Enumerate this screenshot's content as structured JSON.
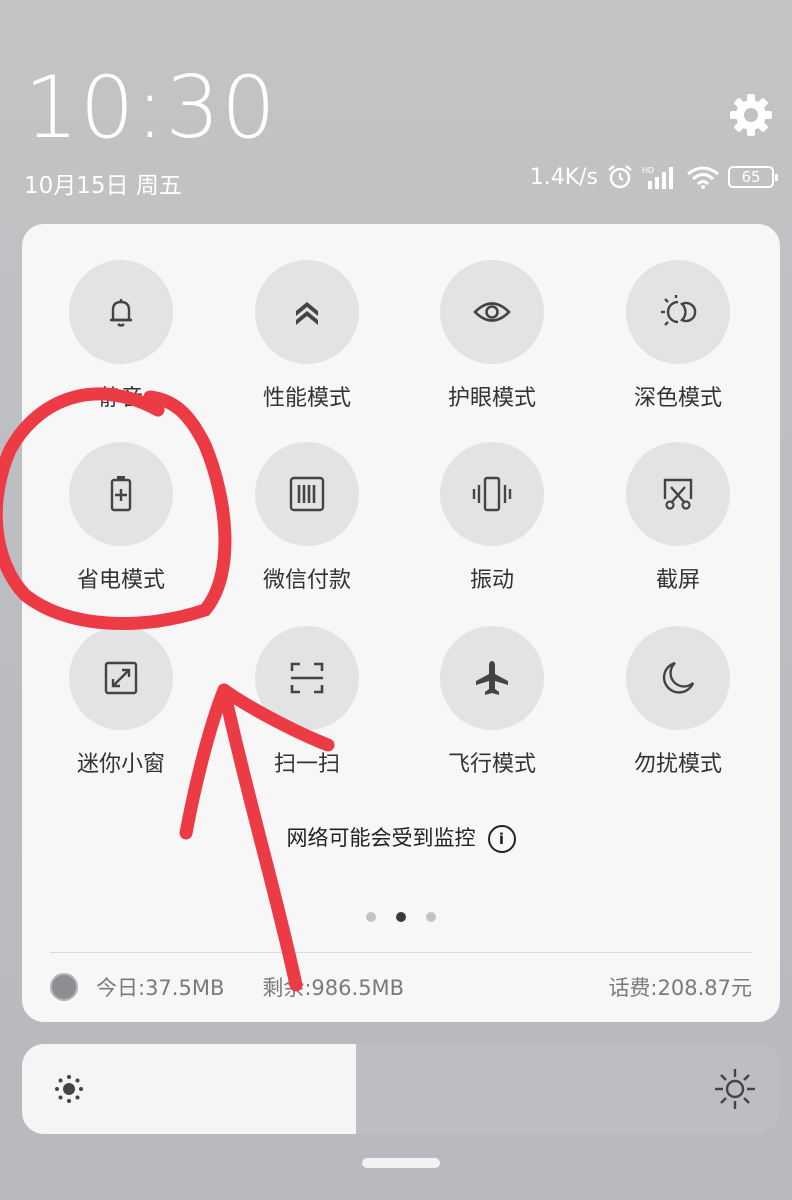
{
  "status_bar": {
    "time": "10:30",
    "date": "10月15日 周五",
    "net_speed": "1.4K/s",
    "battery": "65"
  },
  "icons": [
    "gear-icon",
    "alarm-icon",
    "signal-icon",
    "wifi-icon",
    "battery-icon",
    "bell-icon",
    "performance-icon",
    "eye-icon",
    "sun-moon-icon",
    "battery-saver-icon",
    "wechat-pay-icon",
    "vibrate-icon",
    "screenshot-icon",
    "mini-window-icon",
    "scan-icon",
    "airplane-icon",
    "moon-icon",
    "info-icon",
    "brightness-low-icon",
    "brightness-high-icon"
  ],
  "tiles": [
    {
      "label": "静音",
      "icon": "bell-icon"
    },
    {
      "label": "性能模式",
      "icon": "performance-icon"
    },
    {
      "label": "护眼模式",
      "icon": "eye-icon"
    },
    {
      "label": "深色模式",
      "icon": "sun-moon-icon"
    },
    {
      "label": "省电模式",
      "icon": "battery-saver-icon"
    },
    {
      "label": "微信付款",
      "icon": "wechat-pay-icon"
    },
    {
      "label": "振动",
      "icon": "vibrate-icon"
    },
    {
      "label": "截屏",
      "icon": "screenshot-icon"
    },
    {
      "label": "迷你小窗",
      "icon": "mini-window-icon"
    },
    {
      "label": "扫一扫",
      "icon": "scan-icon"
    },
    {
      "label": "飞行模式",
      "icon": "airplane-icon"
    },
    {
      "label": "勿扰模式",
      "icon": "moon-icon"
    }
  ],
  "notice": {
    "text": "网络可能会受到监控",
    "info": "i"
  },
  "pagination": {
    "pages": 3,
    "current": 2
  },
  "data_usage": {
    "today": "今日:37.5MB",
    "remaining": "剩余:986.5MB",
    "fee": "话费:208.87元"
  },
  "brightness": {
    "level": 0.44
  },
  "annotation_color": "#ec3b45"
}
